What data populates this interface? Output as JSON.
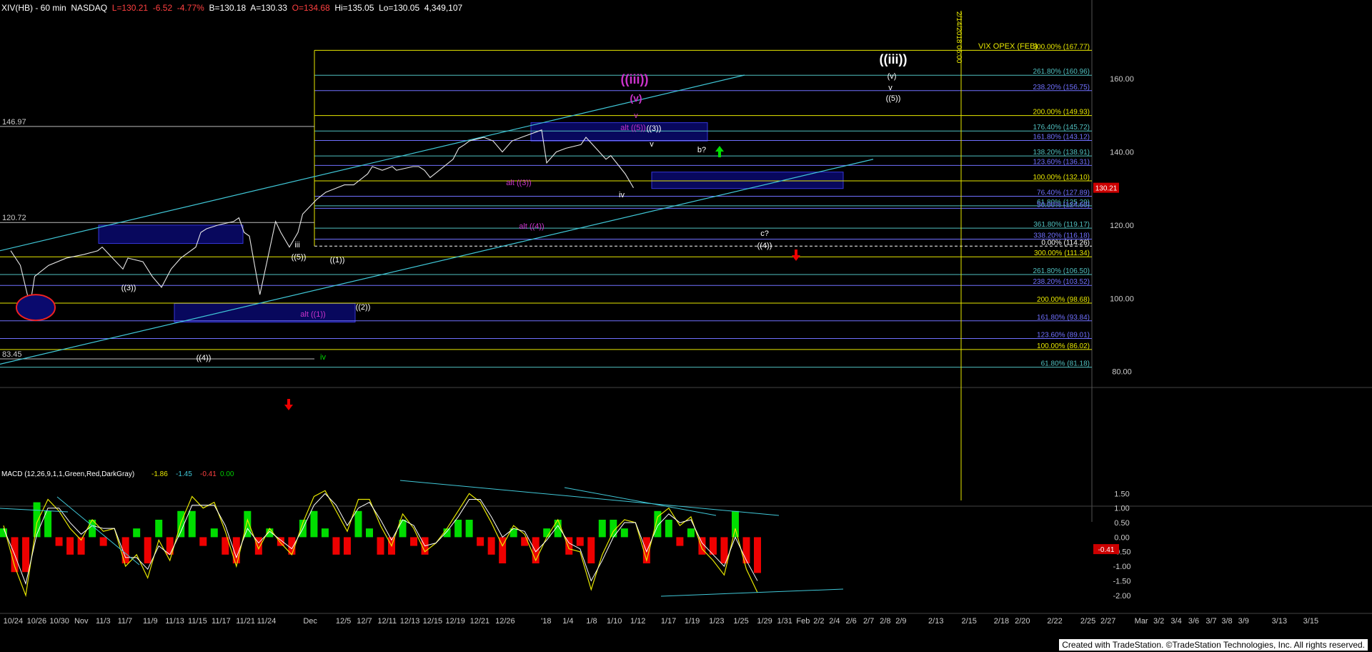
{
  "header": {
    "symbol": "XIV(HB) - 60 min  NASDAQ",
    "L": "L=130.21",
    "chg": "-6.52",
    "pct": "-4.77%",
    "B": "B=130.18",
    "A": "A=130.33",
    "O": "O=134.68",
    "Hi": "Hi=135.05",
    "Lo": "Lo=130.05",
    "vol": "4,349,107"
  },
  "credit": "Created with TradeStation. ©TradeStation Technologies, Inc. All rights reserved.",
  "colors": {
    "bg": "#000000",
    "price": "#e6e6e6",
    "fibYellow": "#e8e800",
    "fibBlue": "#7070ff",
    "fibTeal": "#50c0c0",
    "magenta": "#cc33cc",
    "white": "#ffffff",
    "green": "#00dd00",
    "red": "#ee0000",
    "cyan": "#40c8d8",
    "box": "#0a0a6e"
  },
  "chart_data": {
    "type": "line",
    "title": "XIV(HB) - 60 min NASDAQ",
    "x_ticks": [
      "10/24",
      "10/26",
      "10/30",
      "Nov",
      "11/3",
      "11/7",
      "11/9",
      "11/13",
      "11/15",
      "11/17",
      "11/21",
      "11/24",
      "Dec",
      "12/5",
      "12/7",
      "12/11",
      "12/13",
      "12/15",
      "12/19",
      "12/21",
      "12/26",
      "'18",
      "1/4",
      "1/8",
      "1/10",
      "1/12",
      "1/17",
      "1/19",
      "1/23",
      "1/25",
      "1/29",
      "1/31",
      "Feb",
      "2/2",
      "2/4",
      "2/6",
      "2/7",
      "2/8",
      "2/9",
      "2/13",
      "2/15",
      "2/18",
      "2/20",
      "2/22",
      "2/25",
      "2/27",
      "Mar",
      "3/2",
      "3/4",
      "3/6",
      "3/7",
      "3/8",
      "3/9",
      "3/13",
      "3/15"
    ],
    "y_ticks": [
      80,
      100,
      120,
      140,
      160
    ],
    "ylim": [
      77,
      178
    ],
    "last_price_label": "130.21",
    "level_labels": [
      {
        "text": "146.97",
        "value": 146.97
      },
      {
        "text": "120.72",
        "value": 120.72
      },
      {
        "text": "83.45",
        "value": 83.45
      }
    ],
    "price_series": [
      {
        "x": "10/24",
        "y": 113
      },
      {
        "x": "10/25",
        "y": 109
      },
      {
        "x": "10/26",
        "y": 98
      },
      {
        "x": "10/27",
        "y": 106
      },
      {
        "x": "10/30",
        "y": 109
      },
      {
        "x": "11/1",
        "y": 111
      },
      {
        "x": "11/3",
        "y": 112
      },
      {
        "x": "11/6",
        "y": 113
      },
      {
        "x": "11/7",
        "y": 114
      },
      {
        "x": "11/8",
        "y": 111
      },
      {
        "x": "11/9",
        "y": 108
      },
      {
        "x": "11/10",
        "y": 111
      },
      {
        "x": "11/13",
        "y": 110
      },
      {
        "x": "11/14",
        "y": 106
      },
      {
        "x": "11/15",
        "y": 103
      },
      {
        "x": "11/16",
        "y": 108
      },
      {
        "x": "11/17",
        "y": 111
      },
      {
        "x": "11/20",
        "y": 114
      },
      {
        "x": "11/21",
        "y": 118
      },
      {
        "x": "11/22",
        "y": 119
      },
      {
        "x": "11/24",
        "y": 120
      },
      {
        "x": "11/27",
        "y": 121
      },
      {
        "x": "11/28",
        "y": 122
      },
      {
        "x": "11/29",
        "y": 118
      },
      {
        "x": "11/30",
        "y": 117
      },
      {
        "x": "12/1",
        "y": 101
      },
      {
        "x": "12/4",
        "y": 121
      },
      {
        "x": "12/5",
        "y": 118
      },
      {
        "x": "12/6",
        "y": 114
      },
      {
        "x": "12/7",
        "y": 118
      },
      {
        "x": "12/8",
        "y": 123
      },
      {
        "x": "12/11",
        "y": 127
      },
      {
        "x": "12/12",
        "y": 129
      },
      {
        "x": "12/13",
        "y": 130
      },
      {
        "x": "12/14",
        "y": 131
      },
      {
        "x": "12/15",
        "y": 131
      },
      {
        "x": "12/18",
        "y": 134
      },
      {
        "x": "12/19",
        "y": 136
      },
      {
        "x": "12/20",
        "y": 135
      },
      {
        "x": "12/21",
        "y": 136
      },
      {
        "x": "12/22",
        "y": 135
      },
      {
        "x": "12/26",
        "y": 136
      },
      {
        "x": "12/27",
        "y": 136
      },
      {
        "x": "12/28",
        "y": 135
      },
      {
        "x": "12/29",
        "y": 133
      },
      {
        "x": "1/2",
        "y": 138
      },
      {
        "x": "1/3",
        "y": 141
      },
      {
        "x": "1/4",
        "y": 142
      },
      {
        "x": "1/5",
        "y": 143
      },
      {
        "x": "1/8",
        "y": 144
      },
      {
        "x": "1/9",
        "y": 143
      },
      {
        "x": "1/10",
        "y": 140
      },
      {
        "x": "1/11",
        "y": 143
      },
      {
        "x": "1/12",
        "y": 144
      },
      {
        "x": "1/16",
        "y": 146
      },
      {
        "x": "1/17",
        "y": 137
      },
      {
        "x": "1/18",
        "y": 140
      },
      {
        "x": "1/19",
        "y": 141
      },
      {
        "x": "1/22",
        "y": 142
      },
      {
        "x": "1/23",
        "y": 144
      },
      {
        "x": "1/24",
        "y": 141
      },
      {
        "x": "1/25",
        "y": 138
      },
      {
        "x": "1/26",
        "y": 139
      },
      {
        "x": "1/29",
        "y": 134
      },
      {
        "x": "1/30",
        "y": 130.2
      }
    ],
    "fib_levels": [
      {
        "label": "300.00% (167.77)",
        "value": 167.77,
        "color": "#e8e800"
      },
      {
        "label": "261.80% (160.96)",
        "value": 160.96,
        "color": "#50c0c0"
      },
      {
        "label": "238.20% (156.75)",
        "value": 156.75,
        "color": "#7070ff"
      },
      {
        "label": "200.00% (149.93)",
        "value": 149.93,
        "color": "#e8e800"
      },
      {
        "label": "176.40% (145.72)",
        "value": 145.72,
        "color": "#50c0c0"
      },
      {
        "label": "161.80% (143.12)",
        "value": 143.12,
        "color": "#7070ff"
      },
      {
        "label": "138.20% (138.91)",
        "value": 138.91,
        "color": "#50c0c0"
      },
      {
        "label": "123.60% (136.31)",
        "value": 136.31,
        "color": "#7070ff"
      },
      {
        "label": "100.00% (132.10)",
        "value": 132.1,
        "color": "#e8e800"
      },
      {
        "label": "76.40% (127.89)",
        "value": 127.89,
        "color": "#7070ff"
      },
      {
        "label": "61.80% (125.29)",
        "value": 125.29,
        "color": "#50c0c0"
      },
      {
        "label": "50.00% (124.60)",
        "value": 124.6,
        "color": "#7070ff"
      },
      {
        "label": "361.80% (119.17)",
        "value": 119.17,
        "color": "#50c0c0"
      },
      {
        "label": "338.20% (116.18)",
        "value": 116.18,
        "color": "#7070ff"
      },
      {
        "label": "0.00% (114.26)",
        "value": 114.26,
        "color": "#ffffff"
      },
      {
        "label": "300.00% (111.34)",
        "value": 111.34,
        "color": "#e8e800"
      },
      {
        "label": "261.80% (106.50)",
        "value": 106.5,
        "color": "#50c0c0"
      },
      {
        "label": "238.20% (103.52)",
        "value": 103.52,
        "color": "#7070ff"
      },
      {
        "label": "200.00% (98.68)",
        "value": 98.68,
        "color": "#e8e800"
      },
      {
        "label": "161.80% (93.84)",
        "value": 93.84,
        "color": "#7070ff"
      },
      {
        "label": "123.60% (89.01)",
        "value": 89.01,
        "color": "#7070ff"
      },
      {
        "label": "100.00% (86.02)",
        "value": 86.02,
        "color": "#e8e800"
      },
      {
        "label": "61.80% (81.18)",
        "value": 81.18,
        "color": "#50c0c0"
      }
    ],
    "wave_labels": [
      {
        "text": "((iii))",
        "x": "1/12",
        "y": 169,
        "color": "#ffffff",
        "size": "big"
      },
      {
        "text": "(v)",
        "x": "1/12",
        "y": 164,
        "color": "#ffffff"
      },
      {
        "text": "v",
        "x": "1/12",
        "y": 161,
        "color": "#ffffff"
      },
      {
        "text": "((5))",
        "x": "1/12",
        "y": 157,
        "color": "#ffffff"
      },
      {
        "text": "((iii))",
        "x": "1/4",
        "y": 163,
        "color": "#cc33cc",
        "size": "big"
      },
      {
        "text": "(v)",
        "x": "1/4",
        "y": 157,
        "color": "#cc33cc",
        "size": "med"
      },
      {
        "text": "v",
        "x": "1/4",
        "y": 153,
        "color": "#cc33cc"
      },
      {
        "text": "alt ((5))",
        "x": "1/4",
        "y": 151,
        "color": "#cc33cc"
      },
      {
        "text": "((3))",
        "x": "1/8",
        "y": 151,
        "color": "#ffffff"
      },
      {
        "text": "v",
        "x": "1/12",
        "y": 148,
        "color": "#ffffff"
      },
      {
        "text": "b?",
        "x": "1/23",
        "y": 146,
        "color": "#ffffff"
      },
      {
        "text": "alt ((3))",
        "x": "12/21",
        "y": 140,
        "color": "#cc33cc"
      },
      {
        "text": "iv",
        "x": "1/10",
        "y": 138,
        "color": "#ffffff"
      },
      {
        "text": "alt ((4))",
        "x": "12/29",
        "y": 131,
        "color": "#cc33cc"
      },
      {
        "text": "c?",
        "x": "1/30",
        "y": 128,
        "color": "#ffffff"
      },
      {
        "text": "((4))",
        "x": "1/30",
        "y": 125,
        "color": "#ffffff"
      },
      {
        "text": "iii",
        "x": "11/27",
        "y": 126,
        "color": "#ffffff"
      },
      {
        "text": "((5))",
        "x": "11/27",
        "y": 123,
        "color": "#ffffff"
      },
      {
        "text": "((1))",
        "x": "12/5",
        "y": 122,
        "color": "#ffffff"
      },
      {
        "text": "((3))",
        "x": "11/7",
        "y": 116,
        "color": "#ffffff"
      },
      {
        "text": "((2))",
        "x": "12/7",
        "y": 112,
        "color": "#ffffff"
      },
      {
        "text": "alt ((1))",
        "x": "11/30",
        "y": 110,
        "color": "#cc33cc"
      },
      {
        "text": "((4))",
        "x": "11/15",
        "y": 101,
        "color": "#ffffff"
      },
      {
        "text": "iv",
        "x": "11/30",
        "y": 101,
        "color": "#00dd00"
      }
    ],
    "annotations": [
      {
        "text": "VIX OPEX (FEB)",
        "x": "2/15",
        "y": 171
      },
      {
        "text": "2/14/2018 06:00",
        "x": "2/14",
        "y": 170
      }
    ],
    "macd": {
      "label": "MACD (12,26,9,1,1,Green,Red,DarkGray)",
      "v1": "-1.86",
      "v2": "-1.45",
      "v3": "-0.41",
      "v4": "0.00",
      "ylim": [
        -2.3,
        2.0
      ],
      "y_ticks": [
        -2.0,
        -1.5,
        -1.0,
        -0.5,
        0.0,
        0.5,
        1.0,
        1.5
      ],
      "last_value_label": "-0.41",
      "macd_line": [
        0.4,
        -1.0,
        -2.0,
        0.5,
        1.3,
        0.9,
        0.3,
        -0.1,
        0.6,
        0.2,
        0.3,
        -1.0,
        -0.6,
        -1.4,
        -0.1,
        -0.8,
        0.5,
        1.4,
        1.0,
        1.2,
        0.2,
        -1.0,
        0.6,
        -0.4,
        0.3,
        -0.2,
        -0.6,
        0.5,
        1.4,
        1.6,
        0.9,
        0.2,
        1.3,
        1.3,
        0.4,
        -0.3,
        0.8,
        0.3,
        -0.5,
        -0.2,
        0.3,
        0.9,
        1.5,
        1.2,
        0.5,
        -0.3,
        0.4,
        0.1,
        -0.8,
        0.0,
        0.6,
        -0.4,
        -0.5,
        -1.8,
        -0.6,
        0.2,
        0.6,
        0.5,
        -0.8,
        0.7,
        1.0,
        0.4,
        0.7,
        -0.4,
        -0.8,
        -1.3,
        0.3,
        -1.1,
        -1.9
      ],
      "signal_line": [
        0.3,
        -0.6,
        -1.6,
        0.1,
        1.0,
        1.0,
        0.5,
        0.1,
        0.4,
        0.3,
        0.3,
        -0.7,
        -0.7,
        -1.1,
        -0.3,
        -0.6,
        0.2,
        1.1,
        1.1,
        1.1,
        0.4,
        -0.7,
        0.3,
        -0.2,
        0.2,
        -0.1,
        -0.4,
        0.3,
        1.1,
        1.5,
        1.1,
        0.4,
        1.0,
        1.2,
        0.6,
        -0.1,
        0.6,
        0.4,
        -0.3,
        -0.2,
        0.2,
        0.7,
        1.3,
        1.3,
        0.7,
        0.0,
        0.3,
        0.2,
        -0.5,
        -0.1,
        0.4,
        -0.2,
        -0.4,
        -1.5,
        -0.8,
        0.0,
        0.5,
        0.5,
        -0.5,
        0.4,
        0.8,
        0.5,
        0.6,
        -0.2,
        -0.6,
        -1.0,
        0.0,
        -0.8,
        -1.5
      ],
      "histogram": [
        0.1,
        -0.4,
        -0.4,
        0.4,
        0.3,
        -0.1,
        -0.2,
        -0.2,
        0.2,
        -0.1,
        0.0,
        -0.3,
        0.1,
        -0.3,
        0.2,
        -0.2,
        0.3,
        0.3,
        -0.1,
        0.1,
        -0.2,
        -0.3,
        0.3,
        -0.2,
        0.1,
        -0.1,
        -0.2,
        0.2,
        0.3,
        0.1,
        -0.2,
        -0.2,
        0.3,
        0.1,
        -0.2,
        -0.2,
        0.2,
        -0.1,
        -0.2,
        0.0,
        0.1,
        0.2,
        0.2,
        -0.1,
        -0.2,
        -0.3,
        0.1,
        -0.1,
        -0.3,
        0.1,
        0.2,
        -0.2,
        -0.1,
        -0.3,
        0.2,
        0.2,
        0.1,
        0.0,
        -0.3,
        0.3,
        0.2,
        -0.1,
        0.1,
        -0.2,
        -0.2,
        -0.3,
        0.3,
        -0.3,
        -0.41
      ]
    }
  }
}
